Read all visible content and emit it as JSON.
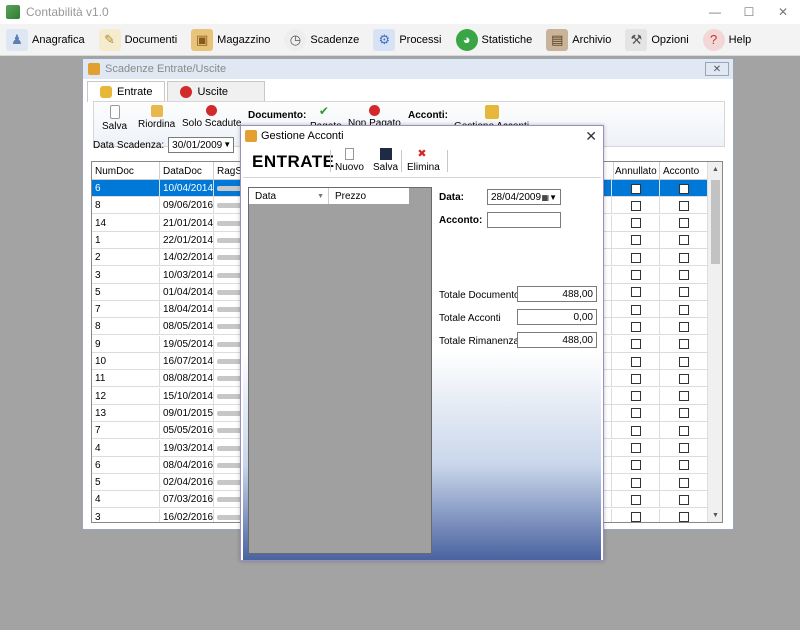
{
  "app": {
    "title": "Contabilità v1.0"
  },
  "menu": [
    {
      "label": "Anagrafica",
      "icon": "people-icon",
      "color": "#5b7fb5"
    },
    {
      "label": "Documenti",
      "icon": "pencil-document-icon",
      "color": "#d6b24a"
    },
    {
      "label": "Magazzino",
      "icon": "box-icon",
      "color": "#c98b2e"
    },
    {
      "label": "Scadenze",
      "icon": "clock-icon",
      "color": "#888888"
    },
    {
      "label": "Processi",
      "icon": "process-icon",
      "color": "#3c6fbf"
    },
    {
      "label": "Statistiche",
      "icon": "chart-globe-icon",
      "color": "#3aa545"
    },
    {
      "label": "Archivio",
      "icon": "archive-icon",
      "color": "#7a5a3a"
    },
    {
      "label": "Opzioni",
      "icon": "tools-icon",
      "color": "#6a6a6a"
    },
    {
      "label": "Help",
      "icon": "help-icon",
      "color": "#c0392b"
    }
  ],
  "scadenze": {
    "title": "Scadenze Entrate/Uscite",
    "tabs": [
      "Entrate",
      "Uscite"
    ],
    "toolbar": {
      "salva": "Salva",
      "riordina": "Riordina",
      "solo_scadute": "Solo Scadute",
      "documento_label": "Documento:",
      "pagato": "Pagato",
      "non_pagato": "Non Pagato",
      "acconti_label": "Acconti:",
      "gestione_acconti": "Gestione Acconti"
    },
    "filter": {
      "label": "Data Scadenza:",
      "value": "30/01/2009"
    },
    "columns": [
      "NumDoc",
      "DataDoc",
      "RagS",
      "Annullato",
      "Acconto"
    ],
    "rows": [
      [
        "6",
        "10/04/2014"
      ],
      [
        "8",
        "09/06/2016"
      ],
      [
        "14",
        "21/01/2014"
      ],
      [
        "1",
        "22/01/2014"
      ],
      [
        "2",
        "14/02/2014"
      ],
      [
        "3",
        "10/03/2014"
      ],
      [
        "5",
        "01/04/2014"
      ],
      [
        "7",
        "18/04/2014"
      ],
      [
        "8",
        "08/05/2014"
      ],
      [
        "9",
        "19/05/2014"
      ],
      [
        "10",
        "16/07/2014"
      ],
      [
        "11",
        "08/08/2014"
      ],
      [
        "12",
        "15/10/2014"
      ],
      [
        "13",
        "09/01/2015"
      ],
      [
        "7",
        "05/05/2016"
      ],
      [
        "4",
        "19/03/2014"
      ],
      [
        "6",
        "08/04/2016"
      ],
      [
        "5",
        "02/04/2016"
      ],
      [
        "4",
        "07/03/2016"
      ],
      [
        "3",
        "16/02/2016"
      ]
    ]
  },
  "dialog": {
    "title": "Gestione Acconti",
    "heading": "ENTRATE",
    "buttons": {
      "nuovo": "Nuovo",
      "salva": "Salva",
      "elimina": "Elimina"
    },
    "list_columns": [
      "Data",
      "Prezzo"
    ],
    "data_label": "Data:",
    "data_value": "28/04/2009",
    "acconto_label": "Acconto:",
    "acconto_value": "",
    "totale_documento_label": "Totale Documento",
    "totale_documento": "488,00",
    "totale_acconti_label": "Totale Acconti",
    "totale_acconti": "0,00",
    "totale_rimanenza_label": "Totale Rimanenza",
    "totale_rimanenza": "488,00"
  }
}
